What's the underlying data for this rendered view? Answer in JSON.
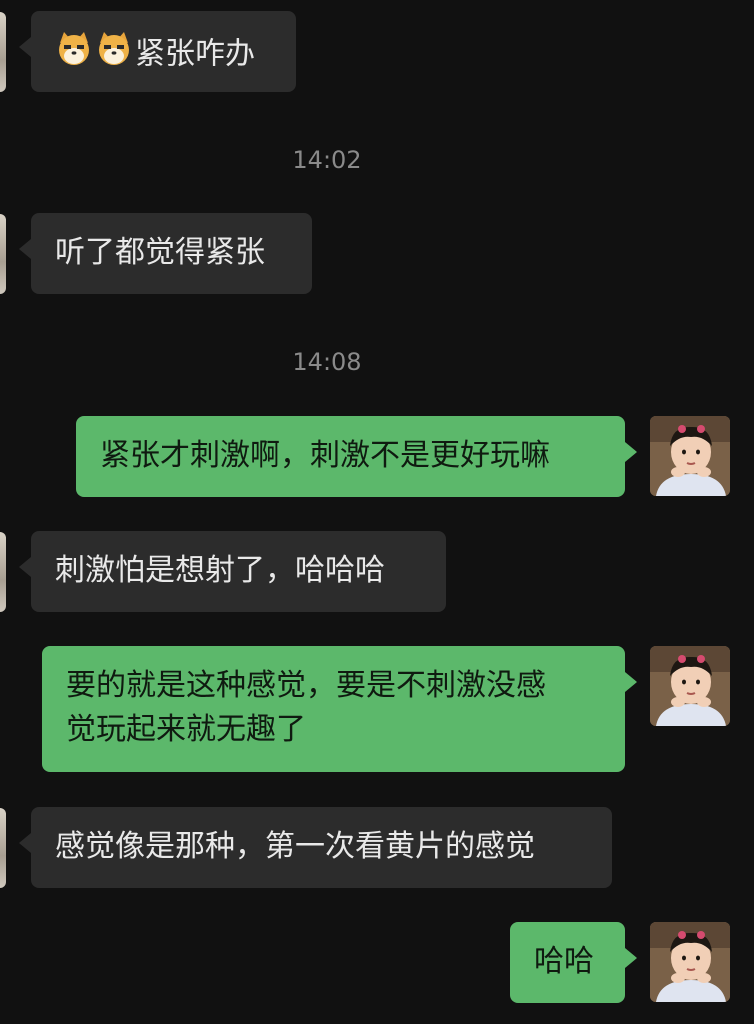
{
  "colors": {
    "background": "#111111",
    "incoming_bubble": "#2c2c2c",
    "outgoing_bubble": "#5cb86b",
    "timestamp": "#8a8a8a"
  },
  "messages": [
    {
      "type": "incoming",
      "emoji": [
        "dog-face-icon",
        "dog-face-icon"
      ],
      "text": "紧张咋办"
    },
    {
      "type": "timestamp",
      "text": "14:02"
    },
    {
      "type": "incoming",
      "text": "听了都觉得紧张"
    },
    {
      "type": "timestamp",
      "text": "14:08"
    },
    {
      "type": "outgoing",
      "text": "紧张才刺激啊，刺激不是更好玩嘛"
    },
    {
      "type": "incoming",
      "text": "刺激怕是想射了，哈哈哈"
    },
    {
      "type": "outgoing",
      "lines": [
        "要的就是这种感觉，要是不刺激没感",
        "觉玩起来就无趣了"
      ]
    },
    {
      "type": "incoming",
      "text": "感觉像是那种，第一次看黄片的感觉"
    },
    {
      "type": "outgoing",
      "text": "哈哈"
    }
  ]
}
